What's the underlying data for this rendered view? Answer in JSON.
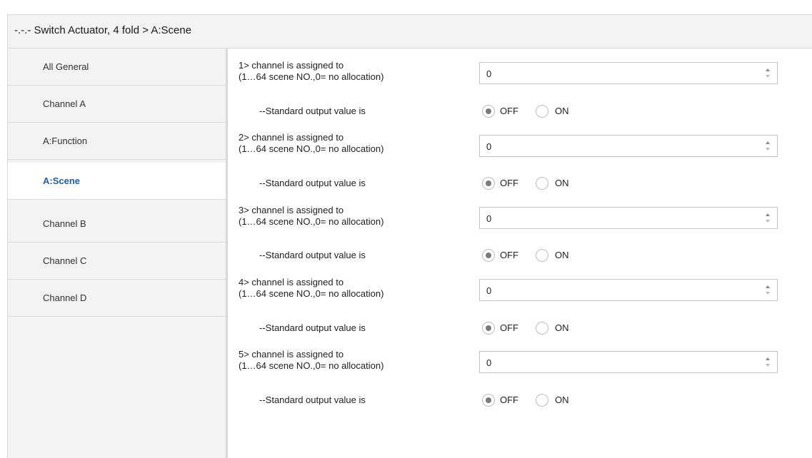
{
  "title": "-.-.- Switch Actuator, 4 fold > A:Scene",
  "sidebar": {
    "items": [
      {
        "label": "All General"
      },
      {
        "label": "Channel A"
      },
      {
        "label": "A:Function"
      },
      {
        "label": "A:Scene",
        "active": true
      },
      {
        "label": "Channel B"
      },
      {
        "label": "Channel C"
      },
      {
        "label": "Channel D"
      }
    ]
  },
  "params": [
    {
      "assign_label": "1> channel is assigned to",
      "range_label": "(1…64 scene NO.,0= no allocation)",
      "value": "0",
      "output_label": "--Standard output value is",
      "off_label": "OFF",
      "on_label": "ON",
      "selected": "OFF"
    },
    {
      "assign_label": "2> channel is assigned to",
      "range_label": "(1…64 scene NO.,0= no allocation)",
      "value": "0",
      "output_label": "--Standard output value is",
      "off_label": "OFF",
      "on_label": "ON",
      "selected": "OFF"
    },
    {
      "assign_label": "3> channel is assigned to",
      "range_label": "(1…64 scene NO.,0= no allocation)",
      "value": "0",
      "output_label": "--Standard output value is",
      "off_label": "OFF",
      "on_label": "ON",
      "selected": "OFF"
    },
    {
      "assign_label": "4> channel is assigned to",
      "range_label": "(1…64 scene NO.,0= no allocation)",
      "value": "0",
      "output_label": "--Standard output value is",
      "off_label": "OFF",
      "on_label": "ON",
      "selected": "OFF"
    },
    {
      "assign_label": "5> channel is assigned to",
      "range_label": "(1…64 scene NO.,0= no allocation)",
      "value": "0",
      "output_label": "--Standard output value is",
      "off_label": "OFF",
      "on_label": "ON",
      "selected": "OFF"
    }
  ],
  "colors": {
    "active_item": "#1e5fa0",
    "sidebar_bg": "#f3f3f3"
  },
  "icons": {
    "spin_up": "triangle-up-icon",
    "spin_down": "triangle-down-icon",
    "radio": "radio-button"
  }
}
